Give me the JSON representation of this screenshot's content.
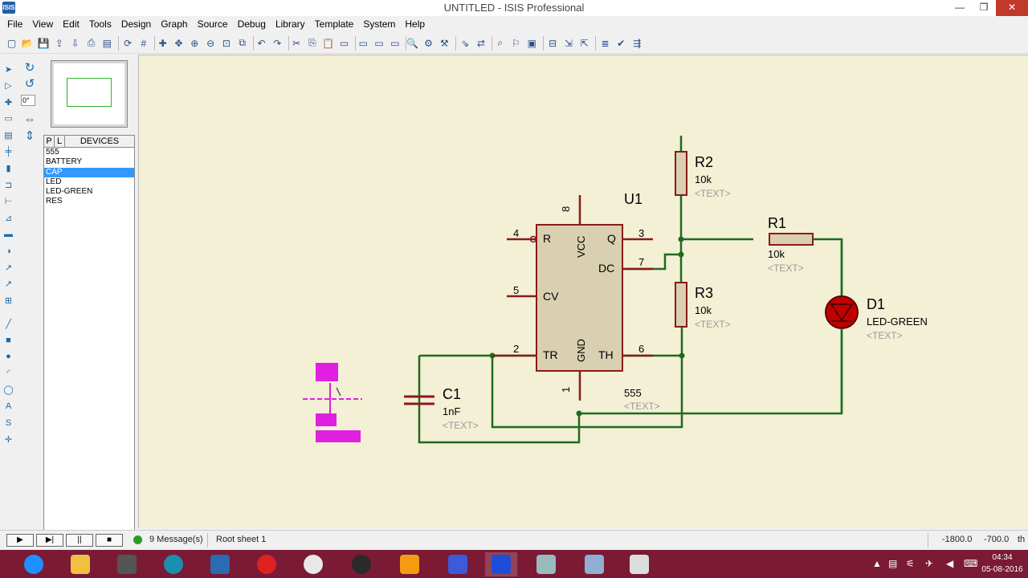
{
  "window": {
    "title": "UNTITLED - ISIS Professional",
    "app_badge": "ISIS",
    "minimize": "—",
    "maximize": "❐",
    "close": "✕"
  },
  "menu": [
    "File",
    "View",
    "Edit",
    "Tools",
    "Design",
    "Graph",
    "Source",
    "Debug",
    "Library",
    "Template",
    "System",
    "Help"
  ],
  "toolbar_icons": [
    "new-icon",
    "open-icon",
    "save-icon",
    "import-icon",
    "export-icon",
    "print-icon",
    "print-setup-icon",
    "refresh-icon",
    "grid-icon",
    "origin-icon",
    "pan-icon",
    "zoom-in-icon",
    "zoom-out-icon",
    "zoom-all-icon",
    "zoom-area-icon",
    "undo-icon",
    "redo-icon",
    "cut-icon",
    "copy-icon",
    "paste-icon",
    "block-copy-icon",
    "block-move-icon",
    "block-rotate-icon",
    "block-delete-icon",
    "pick-device-icon",
    "make-device-icon",
    "packaging-icon",
    "decompose-icon",
    "wire-autorouter-icon",
    "search-tag-icon",
    "property-assign-icon",
    "new-sheet-icon",
    "remove-sheet-icon",
    "zoom-child-icon",
    "exit-parent-icon",
    "bill-of-materials-icon",
    "electrical-rule-check-icon",
    "netlist-ares-icon"
  ],
  "left_tools": [
    "selection-mode-icon",
    "component-mode-icon",
    "junction-dot-icon",
    "wire-label-icon",
    "text-script-icon",
    "buses-icon",
    "subcircuit-icon",
    "terminals-icon",
    "device-pins-icon",
    "graph-icon",
    "tape-recorder-icon",
    "generator-icon",
    "voltage-probe-icon",
    "current-probe-icon",
    "virtual-instrument-icon",
    "line-icon",
    "box-icon",
    "circle-icon",
    "arc-icon",
    "path-icon",
    "text-icon",
    "symbol-icon",
    "marker-icon"
  ],
  "panel": {
    "angle": "0°",
    "tabs": {
      "p": "P",
      "l": "L",
      "caption": "DEVICES"
    },
    "devices": [
      "555",
      "BATTERY",
      "CAP",
      "LED",
      "LED-GREEN",
      "RES"
    ],
    "selected_index": 2
  },
  "schematic": {
    "u1": {
      "ref": "U1",
      "value": "555",
      "text": "<TEXT>",
      "pins": {
        "r": "R",
        "vcc": "VCC",
        "q": "Q",
        "dc": "DC",
        "cv": "CV",
        "tr": "TR",
        "gnd": "GND",
        "th": "TH"
      },
      "pin_numbers": {
        "r": "4",
        "vcc": "8",
        "q": "3",
        "dc": "7",
        "cv": "5",
        "tr": "2",
        "th": "6",
        "gnd": "1"
      }
    },
    "r1": {
      "ref": "R1",
      "value": "10k",
      "text": "<TEXT>"
    },
    "r2": {
      "ref": "R2",
      "value": "10k",
      "text": "<TEXT>"
    },
    "r3": {
      "ref": "R3",
      "value": "10k",
      "text": "<TEXT>"
    },
    "d1": {
      "ref": "D1",
      "value": "LED-GREEN",
      "text": "<TEXT>"
    },
    "c1": {
      "ref": "C1",
      "value": "1nF",
      "text": "<TEXT>"
    },
    "colors": {
      "wire": "#1e6b1e",
      "body": "#d8d0b0",
      "outline": "#8b1a1a",
      "pin": "#8b1a1a",
      "label": "#000000",
      "hidden_text": "#999999",
      "ghost": "#e020e0",
      "led": "#c00000"
    }
  },
  "status": {
    "play": "▶",
    "step": "▶|",
    "pause": "||",
    "stop": "■",
    "messages": "9 Message(s)",
    "sheet": "Root sheet 1",
    "coord_x": "-1800.0",
    "coord_y": "-700.0",
    "unit": "th"
  },
  "taskbar": {
    "apps": [
      "ie-icon",
      "file-explorer-icon",
      "network-icon",
      "media-center-icon",
      "virtualbox-icon",
      "opera-icon",
      "chrome-icon",
      "itunes-icon",
      "vlc-icon",
      "vsm-icon",
      "isis-icon",
      "paint-icon",
      "notepad-icon",
      "screen-recorder-icon"
    ],
    "active_app": "isis-icon",
    "time": "04:34",
    "date": "05-08-2016"
  }
}
